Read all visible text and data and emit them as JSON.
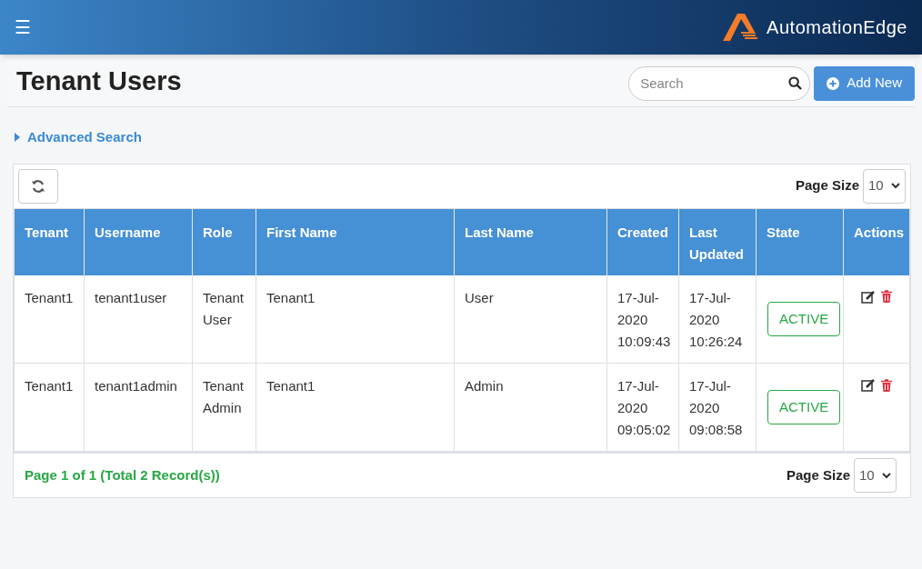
{
  "header": {
    "menu_icon": "☰",
    "brand": "AutomationEdge"
  },
  "page": {
    "title": "Tenant Users",
    "search": {
      "placeholder": "Search"
    },
    "add_button": "Add New"
  },
  "advanced_search": {
    "label": "Advanced Search",
    "expanded": false
  },
  "toolbar": {
    "page_size_label": "Page Size",
    "page_size": "10"
  },
  "table": {
    "columns": [
      "Tenant",
      "Username",
      "Role",
      "First Name",
      "Last Name",
      "Created",
      "Last Updated",
      "State",
      "Actions"
    ],
    "rows": [
      {
        "tenant": "Tenant1",
        "username": "tenant1user",
        "role": "Tenant User",
        "first_name": "Tenant1",
        "last_name": "User",
        "created": "17-Jul-2020 10:09:43",
        "last_updated": "17-Jul-2020 10:26:24",
        "state": {
          "label": "ACTIVE",
          "kind": "active"
        }
      },
      {
        "tenant": "Tenant1",
        "username": "tenant1admin",
        "role": "Tenant Admin",
        "first_name": "Tenant1",
        "last_name": "Admin",
        "created": "17-Jul-2020 09:05:02",
        "last_updated": "17-Jul-2020 09:08:58",
        "state": {
          "label": "ACTIVE",
          "kind": "active"
        }
      }
    ]
  },
  "footer": {
    "summary": "Page 1 of 1 (Total 2 Record(s))",
    "page_size_label": "Page Size",
    "page_size": "10"
  }
}
